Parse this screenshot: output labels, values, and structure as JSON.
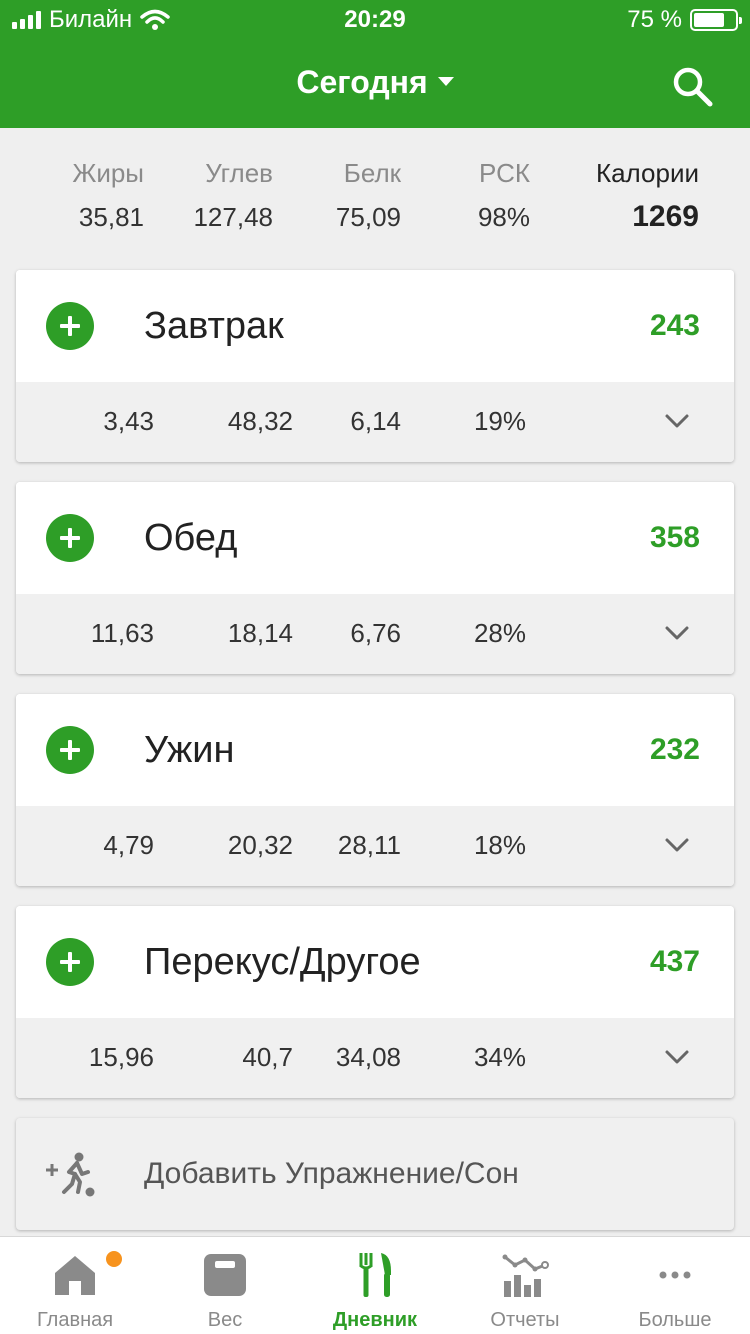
{
  "status_bar": {
    "carrier": "Билайн",
    "time": "20:29",
    "battery": "75 %",
    "battery_level": 0.75
  },
  "header": {
    "title": "Сегодня"
  },
  "summary": {
    "columns": [
      {
        "label": "Жиры",
        "value": "35,81"
      },
      {
        "label": "Углев",
        "value": "127,48"
      },
      {
        "label": "Белк",
        "value": "75,09"
      },
      {
        "label": "РСК",
        "value": "98%"
      },
      {
        "label": "Калории",
        "value": "1269"
      }
    ]
  },
  "meals": [
    {
      "name": "Завтрак",
      "calories": "243",
      "fat": "3,43",
      "carbs": "48,32",
      "protein": "6,14",
      "rdi": "19%"
    },
    {
      "name": "Обед",
      "calories": "358",
      "fat": "11,63",
      "carbs": "18,14",
      "protein": "6,76",
      "rdi": "28%"
    },
    {
      "name": "Ужин",
      "calories": "232",
      "fat": "4,79",
      "carbs": "20,32",
      "protein": "28,11",
      "rdi": "18%"
    },
    {
      "name": "Перекус/Другое",
      "calories": "437",
      "fat": "15,96",
      "carbs": "40,7",
      "protein": "34,08",
      "rdi": "34%"
    }
  ],
  "exercise": {
    "label": "Добавить Упражнение/Сон",
    "icon": "exercise-run-icon"
  },
  "tabbar": {
    "tabs": [
      {
        "label": "Главная",
        "icon": "home-icon"
      },
      {
        "label": "Вес",
        "icon": "scale-icon"
      },
      {
        "label": "Дневник",
        "icon": "fork-knife-icon"
      },
      {
        "label": "Отчеты",
        "icon": "chart-icon"
      },
      {
        "label": "Больше",
        "icon": "more-icon"
      }
    ],
    "active": "Дневник"
  },
  "colors": {
    "brand_green": "#2e9e27",
    "badge_orange": "#f7931e"
  }
}
